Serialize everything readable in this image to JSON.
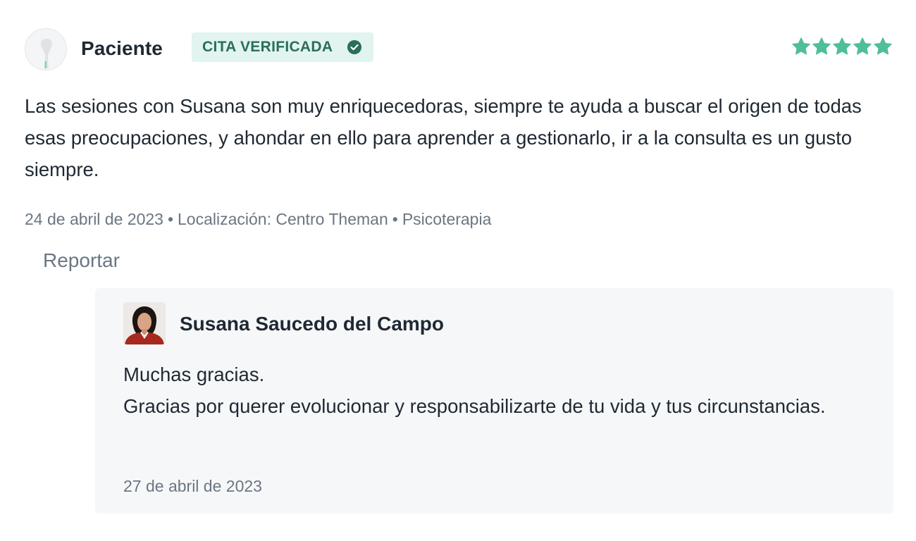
{
  "review": {
    "author": "Paciente",
    "badge_label": "CITA VERIFICADA",
    "rating": 5,
    "rating_max": 5,
    "text": "Las sesiones con Susana son muy enriquecedoras, siempre te ayuda a buscar el origen de todas esas preocupaciones, y ahondar en ello para aprender a gestionarlo, ir a la consulta es un gusto siempre.",
    "date": "24 de abril de 2023",
    "location": "Localización: Centro Theman",
    "service": "Psicoterapia",
    "meta_separator": "•",
    "report_label": "Reportar"
  },
  "reply": {
    "author": "Susana Saucedo del Campo",
    "lines": [
      "Muchas gracias.",
      "Gracias por querer evolucionar y responsabilizarte de tu vida y tus circunstancias."
    ],
    "date": "27 de abril de 2023"
  },
  "colors": {
    "accent_green": "#4fbe9b",
    "badge_bg": "#e2f4ef",
    "badge_text": "#2a6e5b",
    "reply_bg": "#f6f7f9",
    "muted_text": "#6b7682",
    "main_text": "#1f2933"
  },
  "icons": {
    "patient_avatar": "patient-avatar-icon",
    "verified": "check-circle-icon",
    "star": "star-icon"
  }
}
